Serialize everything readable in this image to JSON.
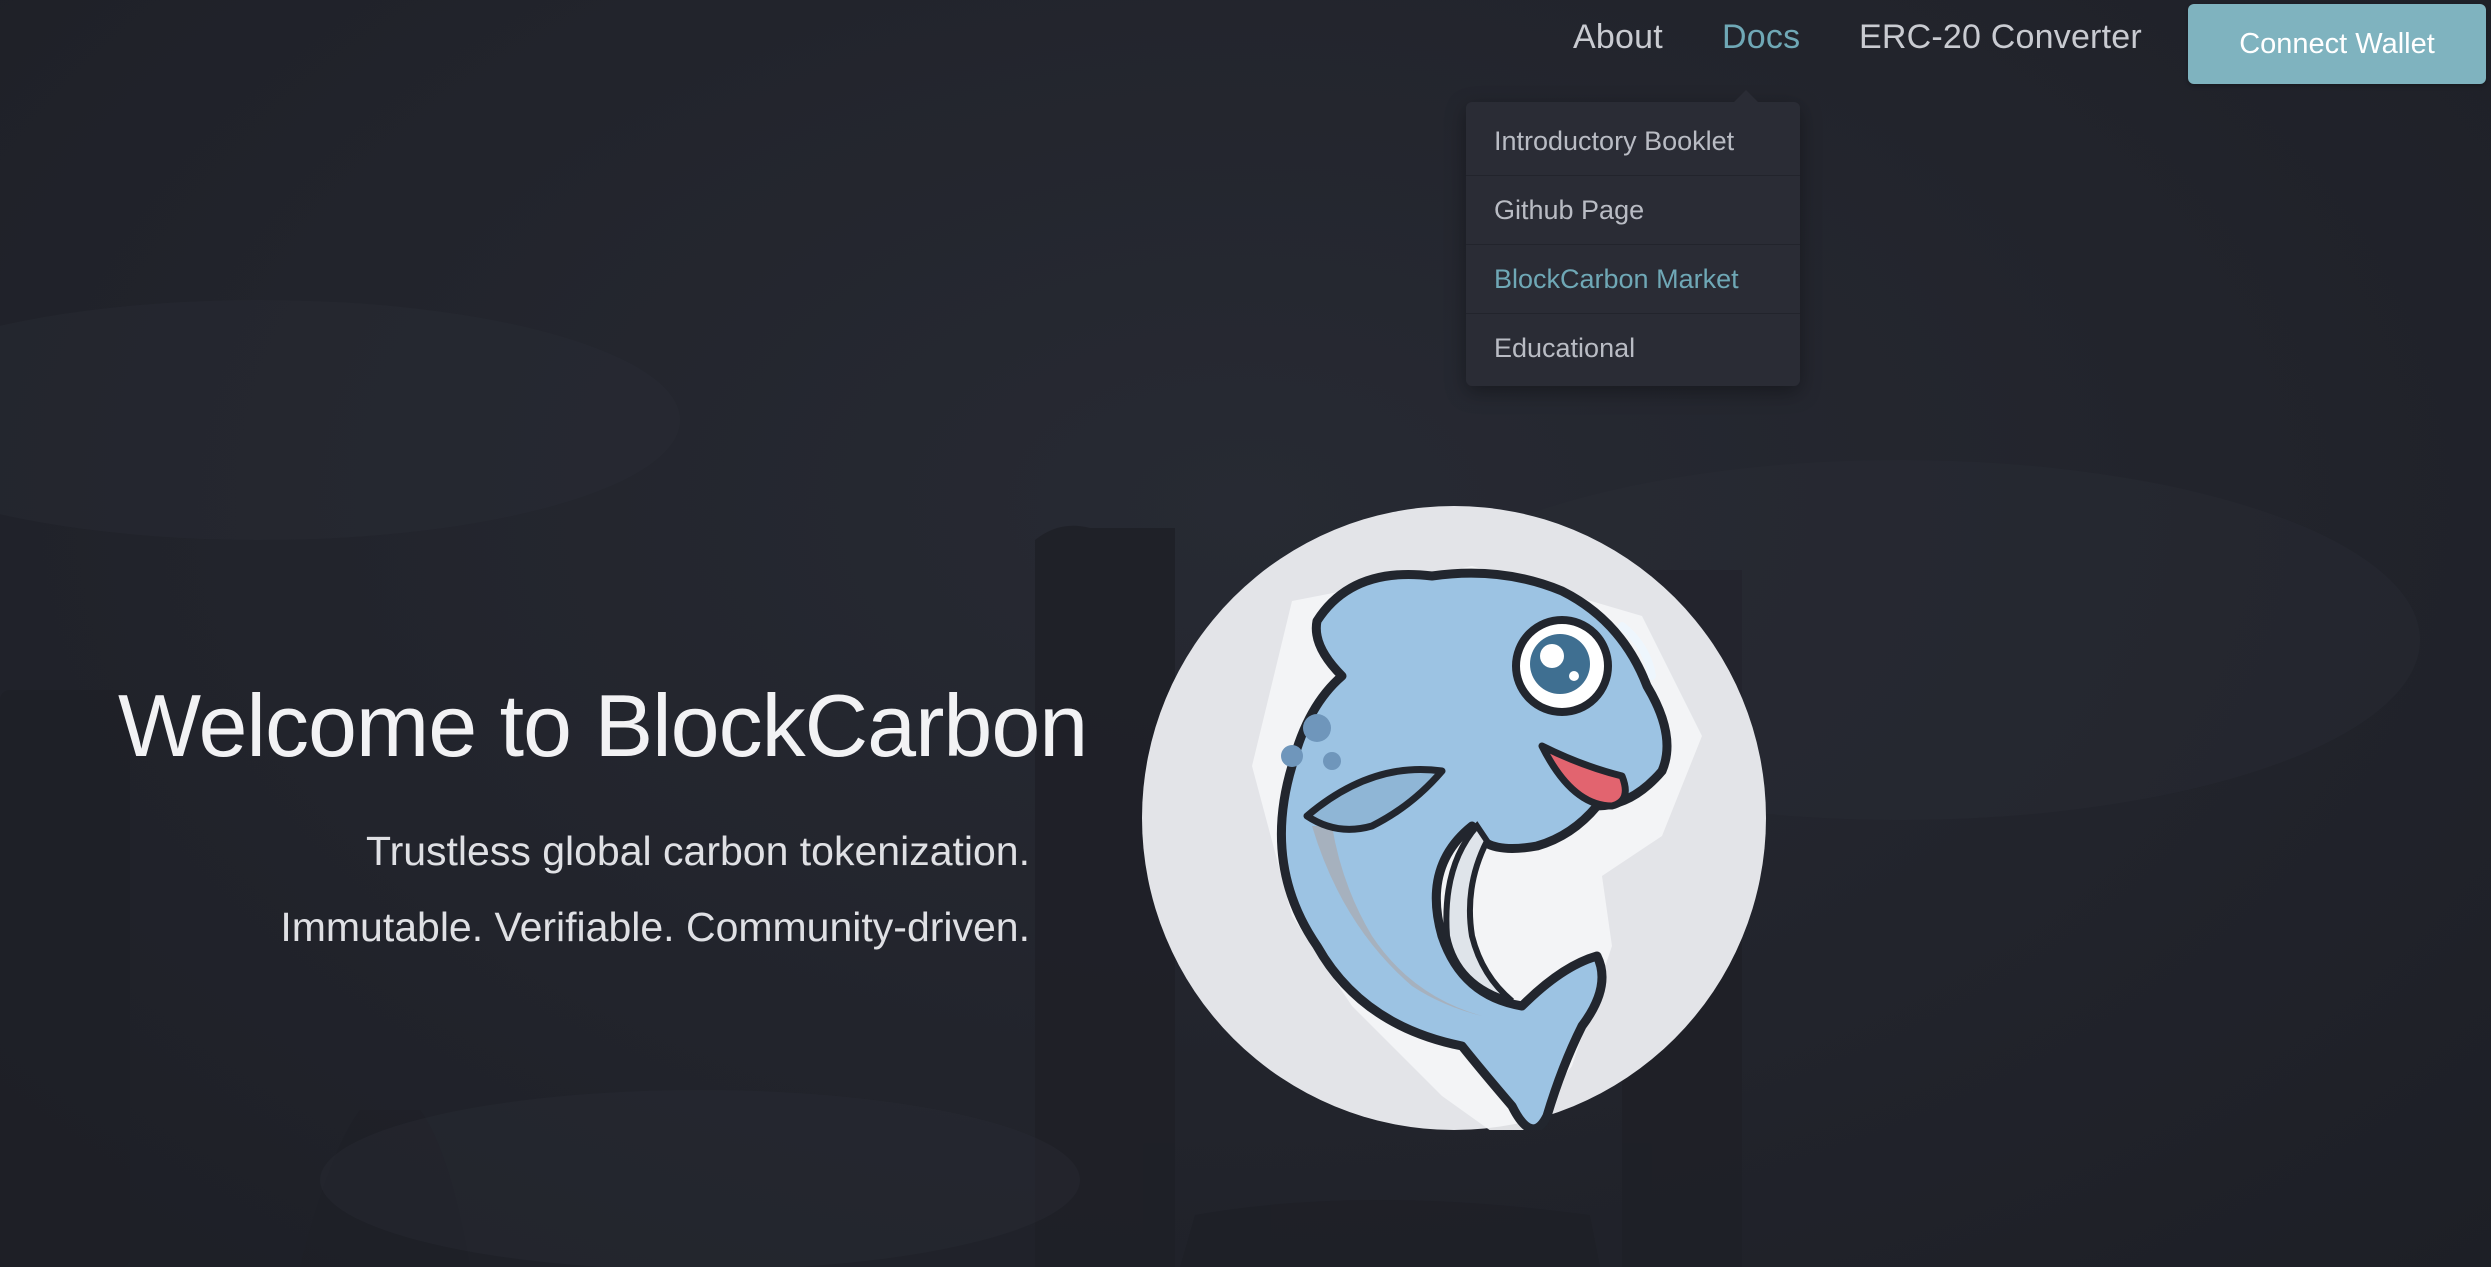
{
  "nav": {
    "about_label": "About",
    "docs_label": "Docs",
    "erc_label": "ERC-20 Converter",
    "connect_label": "Connect Wallet"
  },
  "docs_menu": {
    "items": [
      {
        "label": "Introductory Booklet",
        "active": false
      },
      {
        "label": "Github Page",
        "active": false
      },
      {
        "label": "BlockCarbon Market",
        "active": true
      },
      {
        "label": "Educational",
        "active": false
      }
    ]
  },
  "hero": {
    "title": "Welcome to BlockCarbon",
    "subtitle_line1": "Trustless global carbon tokenization.",
    "subtitle_line2": "Immutable. Verifiable. Community-driven."
  },
  "logo": {
    "icon": "dolphin-mascot-icon"
  },
  "colors": {
    "accent": "#6fa8b6",
    "button": "#7fb3bf",
    "background": "#21232b",
    "dropdown": "#2a2c35"
  }
}
